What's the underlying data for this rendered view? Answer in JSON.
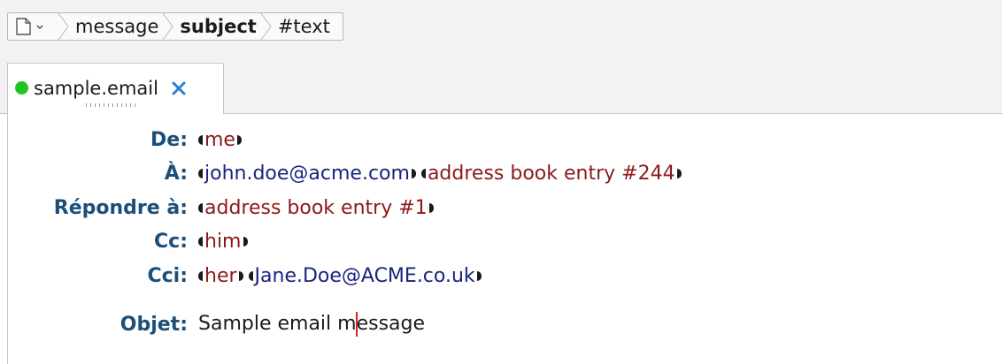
{
  "breadcrumb": {
    "icon": "document-icon",
    "items": [
      "message",
      "subject",
      "#text"
    ]
  },
  "tab": {
    "status_color": "#22c422",
    "label": "sample.email"
  },
  "fields": {
    "from": {
      "label": "De:",
      "values": [
        "me"
      ]
    },
    "to": {
      "label": "À:",
      "values": [
        "john.doe@acme.com",
        "address book entry #244"
      ]
    },
    "reply_to": {
      "label": "Répondre à:",
      "values": [
        "address book entry #1"
      ]
    },
    "cc": {
      "label": "Cc:",
      "values": [
        "him"
      ]
    },
    "bcc": {
      "label": "Cci:",
      "values": [
        "her",
        "Jane.Doe@ACME.co.uk"
      ]
    },
    "subject": {
      "label": "Objet:",
      "value_before_caret": "Sample email m",
      "value_after_caret": "essage"
    }
  },
  "colors": {
    "label": "#1b4f7a",
    "address_entry": "#8b1a1a",
    "email": "#1a237e",
    "caret": "#e02020"
  }
}
